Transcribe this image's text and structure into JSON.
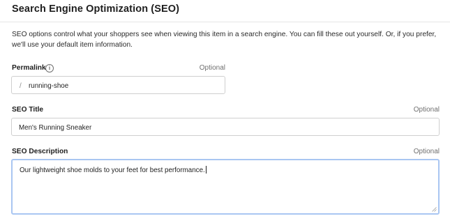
{
  "section": {
    "title": "Search Engine Optimization (SEO)",
    "description": "SEO options control what your shoppers see when viewing this item in a search engine. You can fill these out yourself. Or, if you prefer, we'll use your default item information."
  },
  "permalink": {
    "label": "Permalink",
    "optional": "Optional",
    "prefix": "/",
    "value": "running-shoe",
    "info_icon": "info-icon"
  },
  "seo_title": {
    "label": "SEO Title",
    "optional": "Optional",
    "value": "Men's Running Sneaker"
  },
  "seo_description": {
    "label": "SEO Description",
    "optional": "Optional",
    "value": "Our lightweight shoe molds to your feet for best performance."
  },
  "colors": {
    "focus_border": "#a9c6f2",
    "input_border": "#cfcfcf"
  }
}
